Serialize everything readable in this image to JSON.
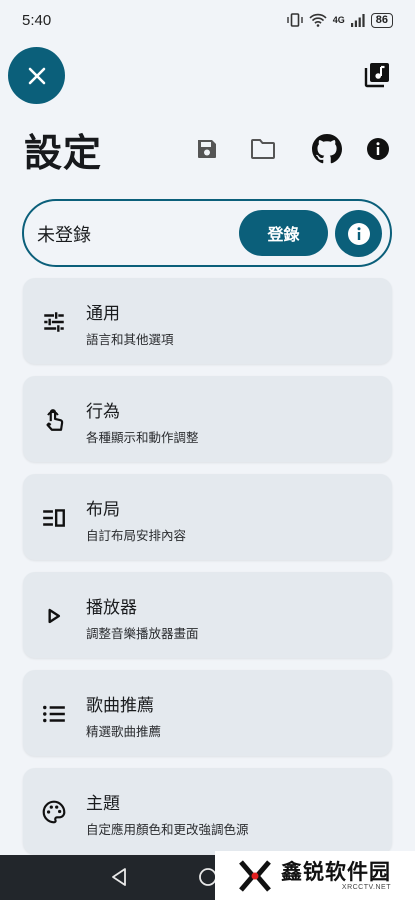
{
  "status_bar": {
    "time": "5:40",
    "network_label": "4G",
    "battery": "86"
  },
  "header": {
    "title": "設定"
  },
  "account": {
    "status": "未登錄",
    "login_label": "登錄"
  },
  "menu": [
    {
      "id": "general",
      "icon": "tune-icon",
      "title": "通用",
      "desc": "語言和其他選項"
    },
    {
      "id": "behavior",
      "icon": "touch-gesture-icon",
      "title": "行為",
      "desc": "各種顯示和動作調整"
    },
    {
      "id": "layout",
      "icon": "layout-icon",
      "title": "布局",
      "desc": "自訂布局安排內容"
    },
    {
      "id": "player",
      "icon": "play-icon",
      "title": "播放器",
      "desc": "調整音樂播放器畫面"
    },
    {
      "id": "recommendations",
      "icon": "list-icon",
      "title": "歌曲推薦",
      "desc": "精選歌曲推薦"
    },
    {
      "id": "theme",
      "icon": "palette-icon",
      "title": "主題",
      "desc": "自定應用顏色和更改強調色源"
    }
  ],
  "watermark": {
    "main": "鑫锐软件园",
    "sub": "XRCCTV.NET"
  },
  "colors": {
    "accent": "#0b5f7a",
    "background": "#f1f4f8",
    "card": "#e4e9ee",
    "nav_bar": "#22262b"
  }
}
